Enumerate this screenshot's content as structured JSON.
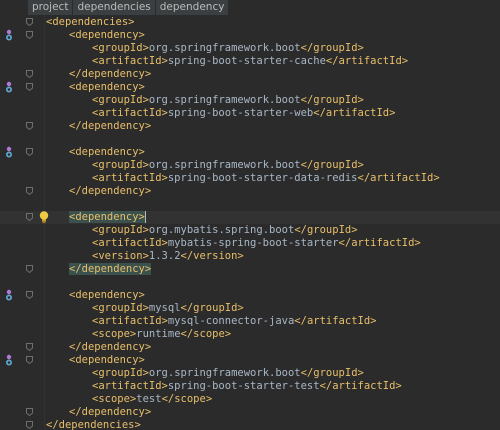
{
  "breadcrumbs": [
    "project",
    "dependencies",
    "dependency"
  ],
  "lines": [
    {
      "indent": 0,
      "parts": [
        {
          "t": "tag",
          "v": "<dependencies>"
        }
      ],
      "fold": true
    },
    {
      "indent": 1,
      "parts": [
        {
          "t": "tag",
          "v": "<dependency>"
        }
      ],
      "fold": true,
      "marker": true
    },
    {
      "indent": 2,
      "parts": [
        {
          "t": "tag",
          "v": "<groupId>"
        },
        {
          "t": "txt",
          "v": "org.springframework.boot"
        },
        {
          "t": "tag",
          "v": "</groupId>"
        }
      ]
    },
    {
      "indent": 2,
      "parts": [
        {
          "t": "tag",
          "v": "<artifactId>"
        },
        {
          "t": "txt",
          "v": "spring-boot-starter-cache"
        },
        {
          "t": "tag",
          "v": "</artifactId>"
        }
      ]
    },
    {
      "indent": 1,
      "parts": [
        {
          "t": "tag",
          "v": "</dependency>"
        }
      ],
      "fold": true
    },
    {
      "indent": 1,
      "parts": [
        {
          "t": "tag",
          "v": "<dependency>"
        }
      ],
      "fold": true,
      "marker": true
    },
    {
      "indent": 2,
      "parts": [
        {
          "t": "tag",
          "v": "<groupId>"
        },
        {
          "t": "txt",
          "v": "org.springframework.boot"
        },
        {
          "t": "tag",
          "v": "</groupId>"
        }
      ]
    },
    {
      "indent": 2,
      "parts": [
        {
          "t": "tag",
          "v": "<artifactId>"
        },
        {
          "t": "txt",
          "v": "spring-boot-starter-web"
        },
        {
          "t": "tag",
          "v": "</artifactId>"
        }
      ]
    },
    {
      "indent": 1,
      "parts": [
        {
          "t": "tag",
          "v": "</dependency>"
        }
      ],
      "fold": true
    },
    {
      "indent": 0,
      "parts": []
    },
    {
      "indent": 1,
      "parts": [
        {
          "t": "tag",
          "v": "<dependency>"
        }
      ],
      "fold": true,
      "marker": true
    },
    {
      "indent": 2,
      "parts": [
        {
          "t": "tag",
          "v": "<groupId>"
        },
        {
          "t": "txt",
          "v": "org.springframework.boot"
        },
        {
          "t": "tag",
          "v": "</groupId>"
        }
      ]
    },
    {
      "indent": 2,
      "parts": [
        {
          "t": "tag",
          "v": "<artifactId>"
        },
        {
          "t": "txt",
          "v": "spring-boot-starter-data-redis"
        },
        {
          "t": "tag",
          "v": "</artifactId>"
        }
      ]
    },
    {
      "indent": 1,
      "parts": [
        {
          "t": "tag",
          "v": "</dependency>"
        }
      ],
      "fold": true
    },
    {
      "indent": 0,
      "parts": []
    },
    {
      "indent": 1,
      "parts": [
        {
          "t": "taghl",
          "v": "<dependency>"
        }
      ],
      "fold": true,
      "current": true,
      "bulb": true
    },
    {
      "indent": 2,
      "parts": [
        {
          "t": "tag",
          "v": "<groupId>"
        },
        {
          "t": "txt",
          "v": "org.mybatis.spring.boot"
        },
        {
          "t": "tag",
          "v": "</groupId>"
        }
      ]
    },
    {
      "indent": 2,
      "parts": [
        {
          "t": "tag",
          "v": "<artifactId>"
        },
        {
          "t": "txt",
          "v": "mybatis-spring-boot-starter"
        },
        {
          "t": "tag",
          "v": "</artifactId>"
        }
      ]
    },
    {
      "indent": 2,
      "parts": [
        {
          "t": "tag",
          "v": "<version>"
        },
        {
          "t": "txt",
          "v": "1.3.2"
        },
        {
          "t": "tag",
          "v": "</version>"
        }
      ]
    },
    {
      "indent": 1,
      "parts": [
        {
          "t": "taghl",
          "v": "</dependency>"
        }
      ],
      "fold": true
    },
    {
      "indent": 0,
      "parts": []
    },
    {
      "indent": 1,
      "parts": [
        {
          "t": "tag",
          "v": "<dependency>"
        }
      ],
      "fold": true,
      "marker": true
    },
    {
      "indent": 2,
      "parts": [
        {
          "t": "tag",
          "v": "<groupId>"
        },
        {
          "t": "txt",
          "v": "mysql"
        },
        {
          "t": "tag",
          "v": "</groupId>"
        }
      ]
    },
    {
      "indent": 2,
      "parts": [
        {
          "t": "tag",
          "v": "<artifactId>"
        },
        {
          "t": "txt",
          "v": "mysql-connector-java"
        },
        {
          "t": "tag",
          "v": "</artifactId>"
        }
      ]
    },
    {
      "indent": 2,
      "parts": [
        {
          "t": "tag",
          "v": "<scope>"
        },
        {
          "t": "txt",
          "v": "runtime"
        },
        {
          "t": "tag",
          "v": "</scope>"
        }
      ]
    },
    {
      "indent": 1,
      "parts": [
        {
          "t": "tag",
          "v": "</dependency>"
        }
      ],
      "fold": true
    },
    {
      "indent": 1,
      "parts": [
        {
          "t": "tag",
          "v": "<dependency>"
        }
      ],
      "fold": true,
      "marker": true
    },
    {
      "indent": 2,
      "parts": [
        {
          "t": "tag",
          "v": "<groupId>"
        },
        {
          "t": "txt",
          "v": "org.springframework.boot"
        },
        {
          "t": "tag",
          "v": "</groupId>"
        }
      ]
    },
    {
      "indent": 2,
      "parts": [
        {
          "t": "tag",
          "v": "<artifactId>"
        },
        {
          "t": "txt",
          "v": "spring-boot-starter-test"
        },
        {
          "t": "tag",
          "v": "</artifactId>"
        }
      ]
    },
    {
      "indent": 2,
      "parts": [
        {
          "t": "tag",
          "v": "<scope>"
        },
        {
          "t": "txt",
          "v": "test"
        },
        {
          "t": "tag",
          "v": "</scope>"
        }
      ]
    },
    {
      "indent": 1,
      "parts": [
        {
          "t": "tag",
          "v": "</dependency>"
        }
      ],
      "fold": true
    },
    {
      "indent": 0,
      "parts": [
        {
          "t": "tag",
          "v": "</dependencies>"
        }
      ],
      "fold": true
    }
  ],
  "colors": {
    "background": "#2b2b2b",
    "tag": "#e8bf6a",
    "text": "#a9b7c6",
    "current_line": "#323232",
    "tag_highlight": "#3b514d",
    "breadcrumb_bg": "#3c3f41"
  },
  "icons": {
    "gutter_marker": "maven-dependency-icon",
    "intention": "lightbulb-icon",
    "fold": "fold-arrow-icon"
  }
}
